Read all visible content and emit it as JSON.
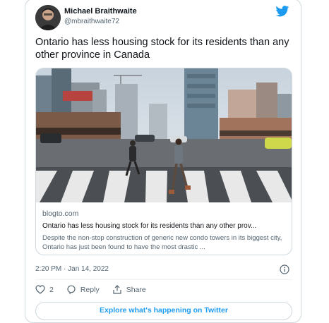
{
  "author": {
    "name": "Michael Braithwaite",
    "handle": "@mbraithwaite72"
  },
  "tweet": {
    "text": "Ontario has less housing stock for its residents than any other province in Canada",
    "timestamp": "2:20 PM · Jan 14, 2022"
  },
  "link_card": {
    "domain": "blogto.com",
    "title": "Ontario has less housing stock for its residents than any other prov...",
    "description": "Despite the non-stop construction of generic new condo towers in its biggest city, Ontario has just been found to have the most drastic ..."
  },
  "actions": {
    "like_count": "2",
    "reply_label": "Reply",
    "share_label": "Share"
  },
  "explore_label": "Explore what's happening on Twitter",
  "icons": [
    "twitter-logo-icon",
    "info-icon",
    "heart-icon",
    "reply-icon",
    "share-icon"
  ],
  "colors": {
    "accent": "#1d9bf0",
    "text": "#0f1419",
    "muted": "#536471",
    "border": "#cfd9de"
  }
}
